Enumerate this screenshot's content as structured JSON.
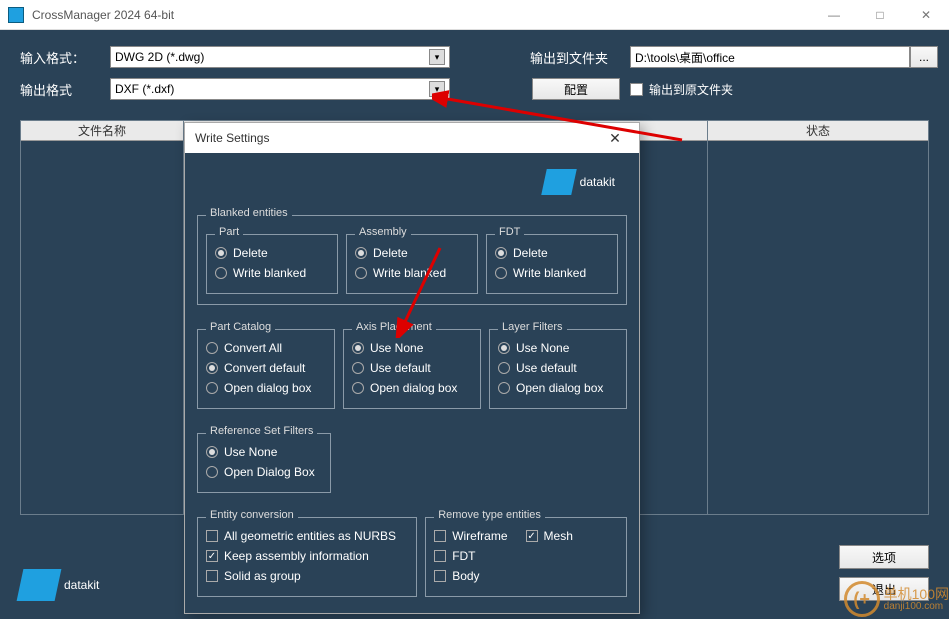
{
  "window": {
    "title": "CrossManager 2024    64-bit",
    "min": "—",
    "max": "□",
    "close": "✕"
  },
  "form": {
    "input_format_label": "输入格式：",
    "input_format_value": "DWG 2D (*.dwg)",
    "output_format_label": "输出格式",
    "output_format_value": "DXF (*.dxf)",
    "output_folder_label": "输出到文件夹",
    "output_folder_value": "D:\\tools\\桌面\\office",
    "browse": "...",
    "config": "配置",
    "output_to_original": "输出到原文件夹"
  },
  "table": {
    "col_filename": "文件名称",
    "col_status": "状态"
  },
  "bottom": {
    "brand": "datakit",
    "options": "选项",
    "exit": "退出"
  },
  "dialog": {
    "title": "Write Settings",
    "brand": "datakit",
    "blanked_entities": "Blanked entities",
    "part": "Part",
    "assembly": "Assembly",
    "fdt": "FDT",
    "delete": "Delete",
    "write_blanked": "Write blanked",
    "part_catalog": "Part Catalog",
    "convert_all": "Convert All",
    "convert_default": "Convert default",
    "open_dialog_box": "Open dialog box",
    "axis_placement": "Axis Placement",
    "use_none": "Use None",
    "use_default": "Use default",
    "layer_filters": "Layer Filters",
    "reference_set_filters": "Reference Set Filters",
    "open_dialog_box_cap": "Open Dialog Box",
    "entity_conversion": "Entity conversion",
    "all_geo_nurbs": "All geometric entities as NURBS",
    "keep_assembly": "Keep assembly information",
    "solid_as_group": "Solid as group",
    "remove_type_entities": "Remove type entities",
    "wireframe": "Wireframe",
    "mesh": "Mesh",
    "fdt2": "FDT",
    "body": "Body"
  },
  "watermark": {
    "line1": "单机100网",
    "line2": "danji100.com"
  }
}
